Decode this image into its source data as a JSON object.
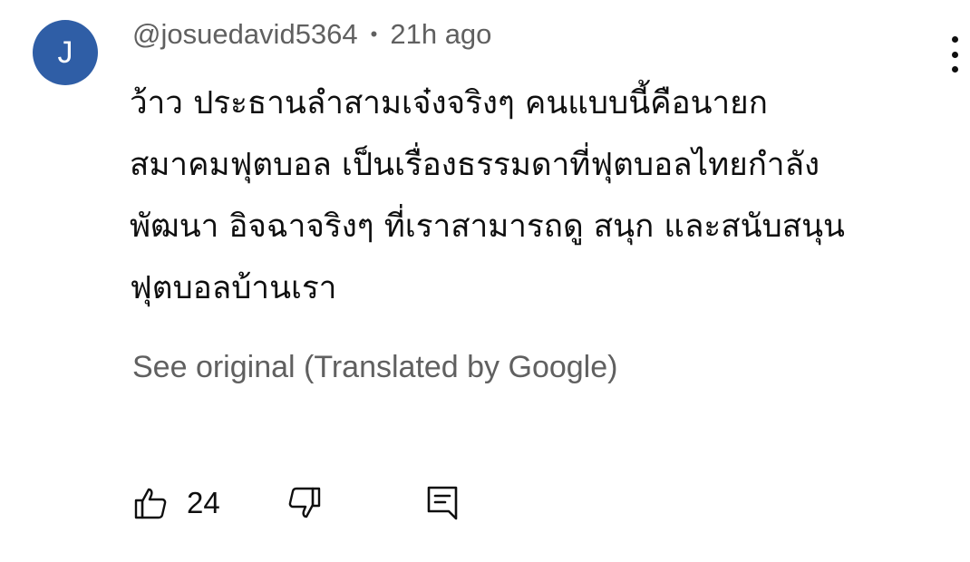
{
  "comment": {
    "avatar_letter": "J",
    "avatar_color": "#2f5ea6",
    "author": "@josuedavid5364",
    "separator": "•",
    "time": "21h ago",
    "text_lines": [
      "ว้าว ประธานลำสามเจ๋งจริงๆ คนแบบนี้คือนายก",
      "สมาคมฟุตบอล เป็นเรื่องธรรมดาที่ฟุตบอลไทยกำลัง",
      "พัฒนา อิจฉาจริงๆ ที่เราสามารถดู สนุก และสนับสนุน",
      "ฟุตบอลบ้านเรา"
    ],
    "see_original": "See original (Translated by Google)",
    "like_count": "24"
  },
  "icons": {
    "more": "more-vertical-icon",
    "like": "thumbs-up-icon",
    "dislike": "thumbs-down-icon",
    "reply": "reply-comment-icon"
  }
}
